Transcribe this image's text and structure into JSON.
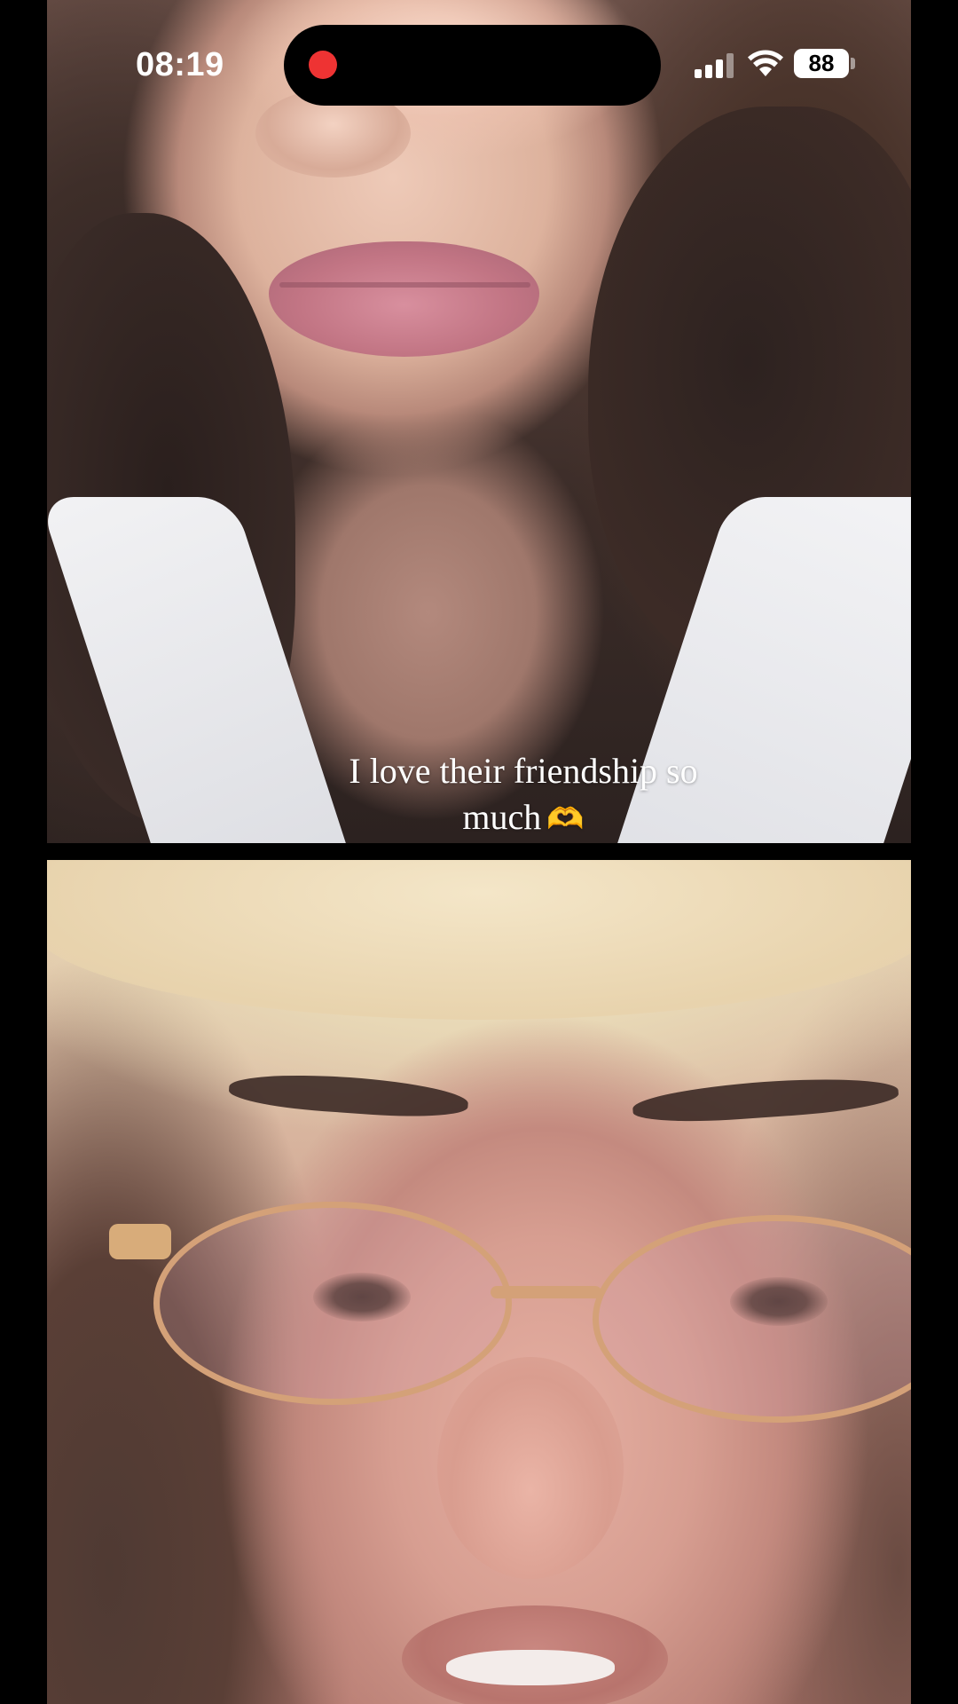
{
  "status_bar": {
    "time": "08:19",
    "battery_level": "88",
    "signal_bars_active": 3,
    "signal_bars_total": 4,
    "recording_indicator_color": "#ee3333"
  },
  "video_tiles": [
    {
      "name": "participant-top",
      "description": "front camera video, face lower half"
    },
    {
      "name": "participant-bottom",
      "description": "front camera video, face with glasses"
    }
  ],
  "caption": {
    "line1": "I love their friendship so",
    "line2": "much",
    "emoji": "🫶"
  },
  "colors": {
    "background": "#000000",
    "caption_text": "#ffffff",
    "emoji": "#f6c94d"
  }
}
